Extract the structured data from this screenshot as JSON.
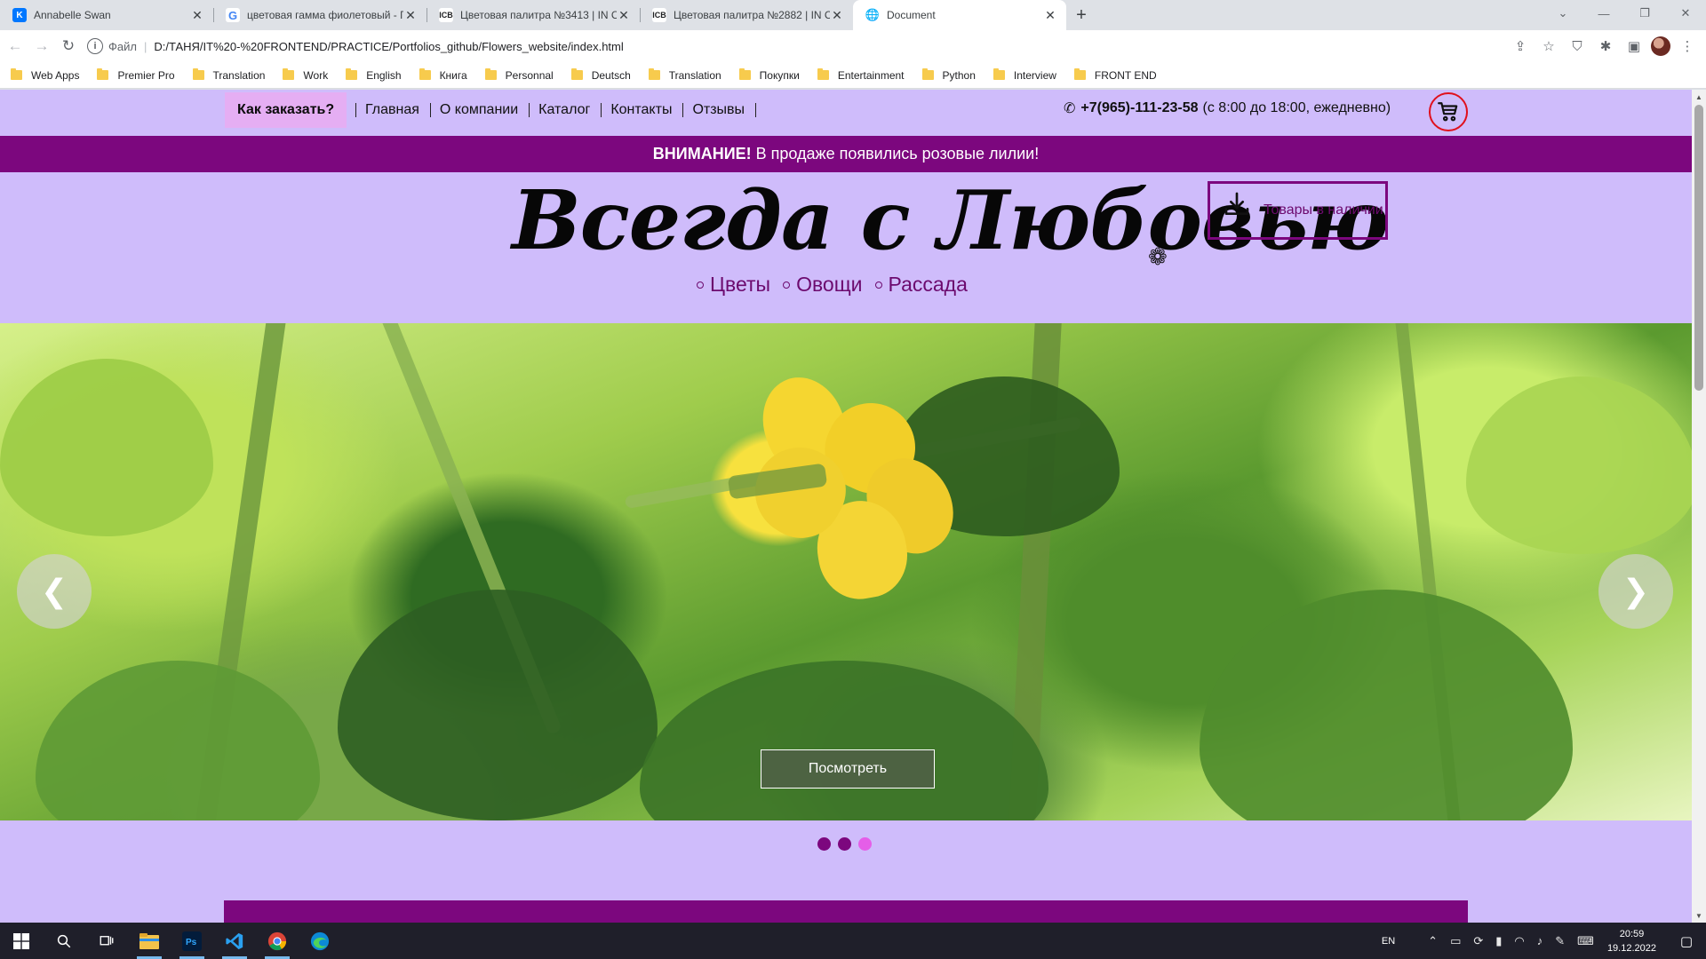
{
  "browser": {
    "tabs": [
      {
        "title": "Annabelle Swan",
        "favicon": "vk-icon",
        "active": false
      },
      {
        "title": "цветовая гамма фиолетовый - Г",
        "favicon": "google-icon",
        "active": false
      },
      {
        "title": "Цветовая палитра №3413 | IN C",
        "favicon": "icb-icon",
        "active": false
      },
      {
        "title": "Цветовая палитра №2882 | IN C",
        "favicon": "icb-icon",
        "active": false
      },
      {
        "title": "Document",
        "favicon": "globe-icon",
        "active": true
      }
    ],
    "address": {
      "scheme_label": "Файл",
      "url": "D:/ТАНЯ/IT%20-%20FRONTEND/PRACTICE/Portfolios_github/Flowers_website/index.html"
    },
    "bookmarks": [
      "Web Apps",
      "Premier Pro",
      "Translation",
      "Work",
      "English",
      "Книга",
      "Personnal",
      "Deutsch",
      "Translation",
      "Покупки",
      "Entertainment",
      "Python",
      "Interview",
      "FRONT END"
    ]
  },
  "site": {
    "nav": {
      "order_label": "Как заказать?",
      "links": [
        "Главная",
        "О компании",
        "Каталог",
        "Контакты",
        "Отзывы"
      ],
      "phone": "+7(965)-111-23-58",
      "hours": "(с 8:00 до 18:00, ежедневно)"
    },
    "notice": {
      "strong": "ВНИМАНИЕ!",
      "text": "В продаже появились розовые лилии!"
    },
    "logo": {
      "text": "Всегда с Любовью",
      "ornament": "❁"
    },
    "categories": [
      "Цветы",
      "Овощи",
      "Рассада"
    ],
    "stock_button": "Товары в наличии",
    "slider": {
      "prev": "❮",
      "next": "❯",
      "cta": "Посмотреть",
      "dots": 3,
      "active_dots": [
        0,
        1
      ]
    }
  },
  "taskbar": {
    "lang": "EN",
    "time": "20:59",
    "date": "19.12.2022"
  },
  "colors": {
    "page_bg": "#cfbcfb",
    "accent_purple": "#7c077e",
    "order_highlight": "#e5aef3",
    "cart_red": "#e0101c"
  }
}
